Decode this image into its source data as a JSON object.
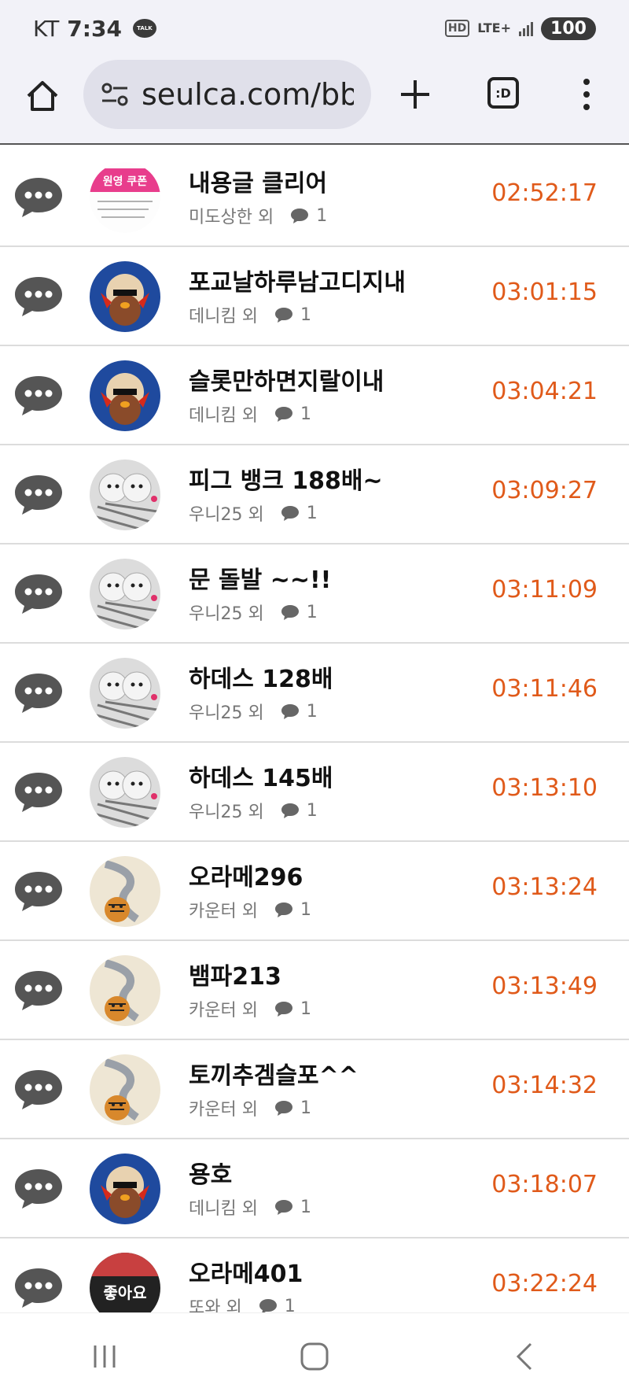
{
  "status": {
    "carrier": "KT",
    "time": "7:34",
    "talk_label": "TALK",
    "hd_label": "HD",
    "network": "LTE+",
    "battery": "100"
  },
  "browser": {
    "url": "seulca.com/bbs",
    "tab_label": ":D"
  },
  "rows": [
    {
      "title": "내용글 클리어",
      "author": "미도상한 외",
      "comments": "1",
      "time": "02:52:17",
      "avatar": "coupon"
    },
    {
      "title": "포교날하루남고디지내",
      "author": "데니킴 외",
      "comments": "1",
      "time": "03:01:15",
      "avatar": "bird"
    },
    {
      "title": "슬롯만하면지랄이내",
      "author": "데니킴 외",
      "comments": "1",
      "time": "03:04:21",
      "avatar": "bird"
    },
    {
      "title": "피그 뱅크 188배~",
      "author": "우니25 외",
      "comments": "1",
      "time": "03:09:27",
      "avatar": "dog"
    },
    {
      "title": "문 돌발 ~~!!",
      "author": "우니25 외",
      "comments": "1",
      "time": "03:11:09",
      "avatar": "dog"
    },
    {
      "title": "하데스 128배",
      "author": "우니25 외",
      "comments": "1",
      "time": "03:11:46",
      "avatar": "dog"
    },
    {
      "title": "하데스 145배",
      "author": "우니25 외",
      "comments": "1",
      "time": "03:13:10",
      "avatar": "dog"
    },
    {
      "title": "오라메296",
      "author": "카운터 외",
      "comments": "1",
      "time": "03:13:24",
      "avatar": "tiger"
    },
    {
      "title": "뱀파213",
      "author": "카운터 외",
      "comments": "1",
      "time": "03:13:49",
      "avatar": "tiger"
    },
    {
      "title": "토끼추겜슬포^^",
      "author": "카운터 외",
      "comments": "1",
      "time": "03:14:32",
      "avatar": "tiger"
    },
    {
      "title": "용호",
      "author": "데니킴 외",
      "comments": "1",
      "time": "03:18:07",
      "avatar": "bird"
    },
    {
      "title": "오라메401",
      "author": "또와 외",
      "comments": "1",
      "time": "03:22:24",
      "avatar": "like"
    }
  ],
  "avatar_text": {
    "coupon": "원영 쿠폰",
    "like": "좋아요"
  },
  "colors": {
    "time": "#e05a1a",
    "accent_pink": "#e83d8c"
  }
}
